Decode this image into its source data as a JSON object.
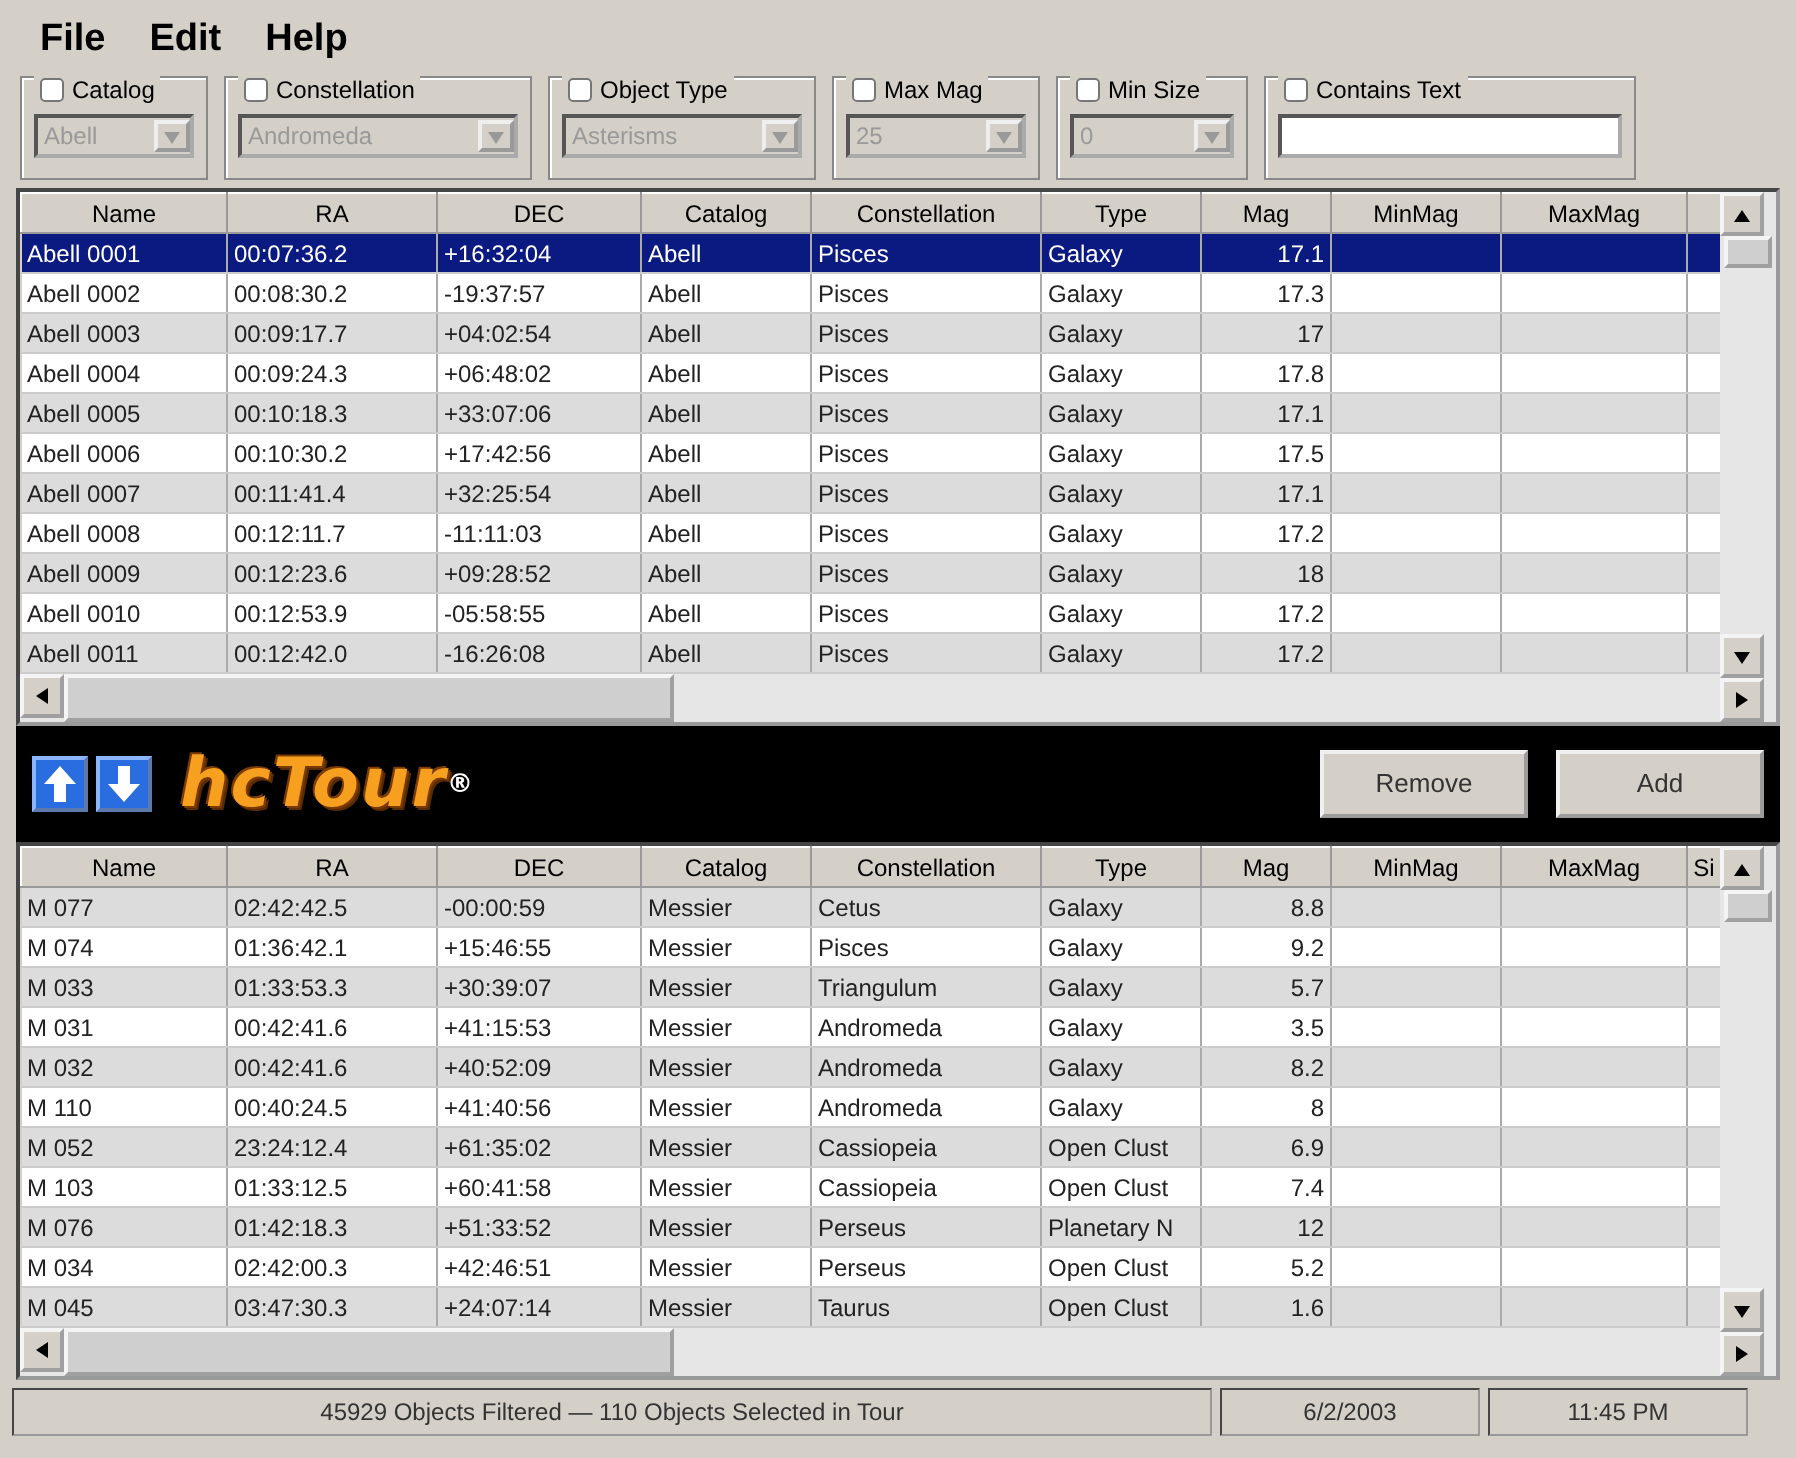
{
  "menu": [
    "File",
    "Edit",
    "Help"
  ],
  "filters": [
    {
      "label": "Catalog",
      "checked": false,
      "kind": "combo",
      "value": "Abell",
      "disabled": true
    },
    {
      "label": "Constellation",
      "checked": false,
      "kind": "combo",
      "value": "Andromeda",
      "disabled": true
    },
    {
      "label": "Object Type",
      "checked": false,
      "kind": "combo",
      "value": "Asterisms",
      "disabled": true
    },
    {
      "label": "Max Mag",
      "checked": false,
      "kind": "combo",
      "value": "25",
      "disabled": true
    },
    {
      "label": "Min Size",
      "checked": false,
      "kind": "combo",
      "value": "0",
      "disabled": true
    },
    {
      "label": "Contains Text",
      "checked": false,
      "kind": "text",
      "disabled": false
    }
  ],
  "top_table": {
    "columns": [
      "Name",
      "RA",
      "DEC",
      "Catalog",
      "Constellation",
      "Type",
      "Mag",
      "MinMag",
      "MaxMag"
    ],
    "rows": [
      {
        "cells": [
          "Abell 0001",
          "00:07:36.2",
          "+16:32:04",
          "Abell",
          "Pisces",
          "Galaxy",
          "17.1"
        ],
        "selected": true
      },
      {
        "cells": [
          "Abell 0002",
          "00:08:30.2",
          "-19:37:57",
          "Abell",
          "Pisces",
          "Galaxy",
          "17.3"
        ],
        "selected": false
      },
      {
        "cells": [
          "Abell 0003",
          "00:09:17.7",
          "+04:02:54",
          "Abell",
          "Pisces",
          "Galaxy",
          "17"
        ],
        "selected": false
      },
      {
        "cells": [
          "Abell 0004",
          "00:09:24.3",
          "+06:48:02",
          "Abell",
          "Pisces",
          "Galaxy",
          "17.8"
        ],
        "selected": false
      },
      {
        "cells": [
          "Abell 0005",
          "00:10:18.3",
          "+33:07:06",
          "Abell",
          "Pisces",
          "Galaxy",
          "17.1"
        ],
        "selected": false
      },
      {
        "cells": [
          "Abell 0006",
          "00:10:30.2",
          "+17:42:56",
          "Abell",
          "Pisces",
          "Galaxy",
          "17.5"
        ],
        "selected": false
      },
      {
        "cells": [
          "Abell 0007",
          "00:11:41.4",
          "+32:25:54",
          "Abell",
          "Pisces",
          "Galaxy",
          "17.1"
        ],
        "selected": false
      },
      {
        "cells": [
          "Abell 0008",
          "00:12:11.7",
          "-11:11:03",
          "Abell",
          "Pisces",
          "Galaxy",
          "17.2"
        ],
        "selected": false
      },
      {
        "cells": [
          "Abell 0009",
          "00:12:23.6",
          "+09:28:52",
          "Abell",
          "Pisces",
          "Galaxy",
          "18"
        ],
        "selected": false
      },
      {
        "cells": [
          "Abell 0010",
          "00:12:53.9",
          "-05:58:55",
          "Abell",
          "Pisces",
          "Galaxy",
          "17.2"
        ],
        "selected": false
      },
      {
        "cells": [
          "Abell 0011",
          "00:12:42.0",
          "-16:26:08",
          "Abell",
          "Pisces",
          "Galaxy",
          "17.2"
        ],
        "selected": false
      }
    ]
  },
  "toolbar": {
    "logo": "hcTour",
    "logo_mark": "®",
    "buttons": [
      "Remove",
      "Add"
    ]
  },
  "bottom_table": {
    "columns": [
      "Name",
      "RA",
      "DEC",
      "Catalog",
      "Constellation",
      "Type",
      "Mag",
      "MinMag",
      "MaxMag",
      "Si"
    ],
    "rows": [
      {
        "cells": [
          "M 077",
          "02:42:42.5",
          "-00:00:59",
          "Messier",
          "Cetus",
          "Galaxy",
          "8.8"
        ],
        "selected": false
      },
      {
        "cells": [
          "M 074",
          "01:36:42.1",
          "+15:46:55",
          "Messier",
          "Pisces",
          "Galaxy",
          "9.2"
        ],
        "selected": false
      },
      {
        "cells": [
          "M 033",
          "01:33:53.3",
          "+30:39:07",
          "Messier",
          "Triangulum",
          "Galaxy",
          "5.7"
        ],
        "selected": false
      },
      {
        "cells": [
          "M 031",
          "00:42:41.6",
          "+41:15:53",
          "Messier",
          "Andromeda",
          "Galaxy",
          "3.5"
        ],
        "selected": false
      },
      {
        "cells": [
          "M 032",
          "00:42:41.6",
          "+40:52:09",
          "Messier",
          "Andromeda",
          "Galaxy",
          "8.2"
        ],
        "selected": false
      },
      {
        "cells": [
          "M 110",
          "00:40:24.5",
          "+41:40:56",
          "Messier",
          "Andromeda",
          "Galaxy",
          "8"
        ],
        "selected": false
      },
      {
        "cells": [
          "M 052",
          "23:24:12.4",
          "+61:35:02",
          "Messier",
          "Cassiopeia",
          "Open Clust",
          "6.9"
        ],
        "selected": false
      },
      {
        "cells": [
          "M 103",
          "01:33:12.5",
          "+60:41:58",
          "Messier",
          "Cassiopeia",
          "Open Clust",
          "7.4"
        ],
        "selected": false
      },
      {
        "cells": [
          "M 076",
          "01:42:18.3",
          "+51:33:52",
          "Messier",
          "Perseus",
          "Planetary N",
          "12"
        ],
        "selected": false
      },
      {
        "cells": [
          "M 034",
          "02:42:00.3",
          "+42:46:51",
          "Messier",
          "Perseus",
          "Open Clust",
          "5.2"
        ],
        "selected": false
      },
      {
        "cells": [
          "M 045",
          "03:47:30.3",
          "+24:07:14",
          "Messier",
          "Taurus",
          "Open Clust",
          "1.6"
        ],
        "selected": false
      }
    ]
  },
  "status_bar": [
    "45929 Objects Filtered — 110 Objects Selected in Tour",
    "6/2/2003",
    "11:45 PM"
  ]
}
